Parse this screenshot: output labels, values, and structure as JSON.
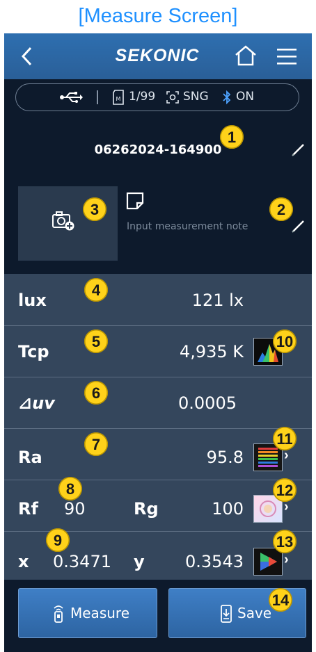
{
  "caption": "[Measure Screen]",
  "app": {
    "brand": "SEKONIC"
  },
  "status_bar": {
    "memory": "1/99",
    "mode": "SNG",
    "bluetooth": "ON"
  },
  "callouts": [
    "1",
    "2",
    "3",
    "4",
    "5",
    "6",
    "7",
    "8",
    "9",
    "10",
    "11",
    "12",
    "13",
    "14"
  ],
  "measurement": {
    "id": "06262024-164900",
    "note_placeholder": "Input measurement note"
  },
  "results": {
    "lux": {
      "label": "lux",
      "value": "121 lx"
    },
    "tcp": {
      "label": "Tcp",
      "value": "4,935 K"
    },
    "duv": {
      "label": "⊿uv",
      "value": "0.0005"
    },
    "ra": {
      "label": "Ra",
      "value": "95.8"
    },
    "rf": {
      "label": "Rf",
      "value": "90"
    },
    "rg": {
      "label": "Rg",
      "value": "100"
    },
    "x": {
      "label": "x",
      "value": "0.3471"
    },
    "y": {
      "label": "y",
      "value": "0.3543"
    }
  },
  "buttons": {
    "measure": "Measure",
    "save": "Save"
  },
  "colors": {
    "accent": "#1e90ff",
    "appbar": "#2e6fb0",
    "background": "#0d1a2c",
    "panel": "#34465c",
    "callout": "#ffd21a"
  },
  "icons": [
    "back-arrow-icon",
    "home-icon",
    "menu-icon",
    "usb-icon",
    "memory-card-icon",
    "sync-icon",
    "bluetooth-icon",
    "pencil-icon",
    "camera-add-icon",
    "note-icon",
    "spectrum-icon",
    "color-rendering-icon",
    "tm30-icon",
    "chromaticity-icon",
    "light-meter-icon",
    "save-device-icon"
  ]
}
